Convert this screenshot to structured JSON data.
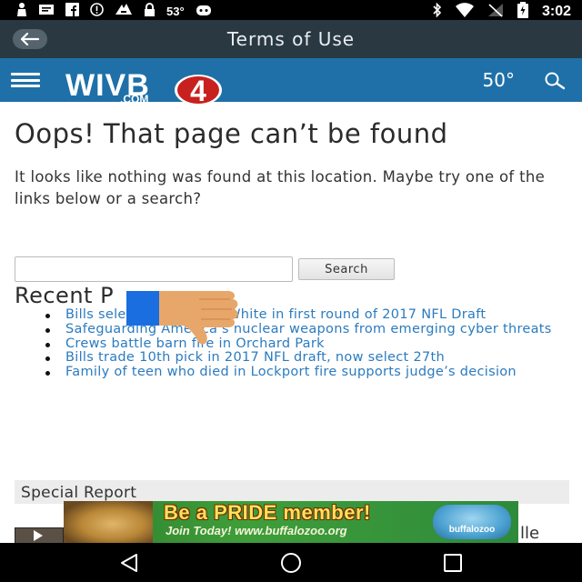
{
  "status_bar": {
    "temperature": "53°",
    "time": "3:02"
  },
  "app_bar": {
    "title": "Terms of Use"
  },
  "site_header": {
    "logo_text": "WIVB",
    "logo_sub": ".COM",
    "logo_number": "4",
    "temperature": "50°"
  },
  "main": {
    "title": "Oops! That page can’t be found",
    "intro": "It looks like nothing was found at this location. Maybe try one of the links below or a search?",
    "search": {
      "placeholder": "",
      "button_label": "Search"
    },
    "recent_heading": "Recent P",
    "recent_posts": [
      "Bills select Tre’Davious White in first round of 2017 NFL Draft",
      "Safeguarding America’s nuclear weapons from emerging cyber threats",
      "Crews battle barn fire in Orchard Park",
      "Bills trade 10th pick in 2017 NFL draft, now select 27th",
      "Family of teen who died in Lockport fire supports judge’s decision"
    ]
  },
  "special_report": {
    "label": "Special Report",
    "peek_text": "lle"
  },
  "ad": {
    "headline": "Be a PRIDE member!",
    "sub": "Join Today! www.buffalozoo.org",
    "logo_text": "buffalozoo"
  },
  "colors": {
    "app_bar": "#2a3842",
    "site_header": "#1f70a8",
    "link": "#2b7bbf",
    "thumbs_blue": "#1a6ee0",
    "thumbs_hand": "#e8a76a"
  }
}
